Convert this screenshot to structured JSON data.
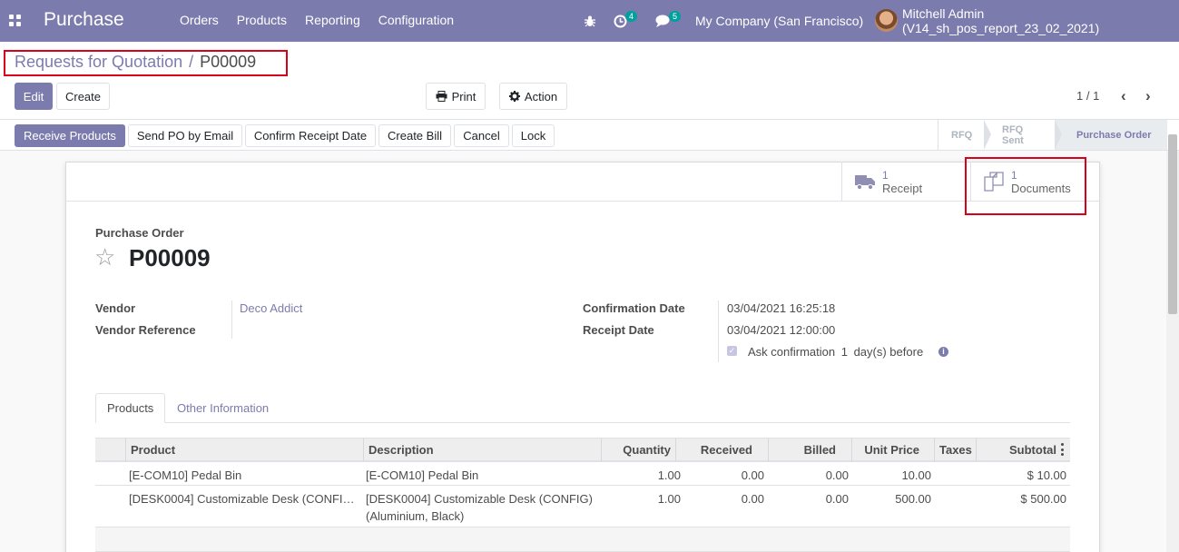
{
  "navbar": {
    "brand": "Purchase",
    "menu": [
      "Orders",
      "Products",
      "Reporting",
      "Configuration"
    ],
    "activity_count": "4",
    "messages_count": "5",
    "company": "My Company (San Francisco)",
    "user": "Mitchell Admin (V14_sh_pos_report_23_02_2021)"
  },
  "breadcrumb": {
    "parent": "Requests for Quotation",
    "separator": "/",
    "current": "P00009"
  },
  "control_panel": {
    "edit_label": "Edit",
    "create_label": "Create",
    "print_label": "Print",
    "action_label": "Action",
    "pager": "1 / 1"
  },
  "statusbar": {
    "buttons": [
      "Receive Products",
      "Send PO by Email",
      "Confirm Receipt Date",
      "Create Bill",
      "Cancel",
      "Lock"
    ],
    "stages": [
      "RFQ",
      "RFQ Sent",
      "Purchase Order"
    ],
    "active_stage": "Purchase Order"
  },
  "smart_buttons": {
    "receipt": {
      "count": "1",
      "label": "Receipt"
    },
    "documents": {
      "count": "1",
      "label": "Documents"
    }
  },
  "form": {
    "title_label": "Purchase Order",
    "name": "P00009",
    "vendor_label": "Vendor",
    "vendor_value": "Deco Addict",
    "vendor_ref_label": "Vendor Reference",
    "vendor_ref_value": "",
    "confirmation_date_label": "Confirmation Date",
    "confirmation_date_value": "03/04/2021 16:25:18",
    "receipt_date_label": "Receipt Date",
    "receipt_date_value": "03/04/2021 12:00:00",
    "ask_confirmation_prefix": "Ask confirmation",
    "ask_confirmation_days": "1",
    "ask_confirmation_suffix": "day(s) before",
    "ask_confirmation_checked": true
  },
  "tabs": [
    "Products",
    "Other Information"
  ],
  "order_lines": {
    "columns": [
      "Product",
      "Description",
      "Quantity",
      "Received",
      "Billed",
      "Unit Price",
      "Taxes",
      "Subtotal"
    ],
    "rows": [
      {
        "product": "[E-COM10] Pedal Bin",
        "description": "[E-COM10] Pedal Bin",
        "description_line2": "",
        "quantity": "1.00",
        "received": "0.00",
        "billed": "0.00",
        "unit_price": "10.00",
        "taxes": "",
        "subtotal": "$ 10.00"
      },
      {
        "product": "[DESK0004] Customizable Desk (CONFI…",
        "description": "[DESK0004] Customizable Desk (CONFIG)",
        "description_line2": "(Aluminium, Black)",
        "quantity": "1.00",
        "received": "0.00",
        "billed": "0.00",
        "unit_price": "500.00",
        "taxes": "",
        "subtotal": "$ 500.00"
      }
    ]
  }
}
